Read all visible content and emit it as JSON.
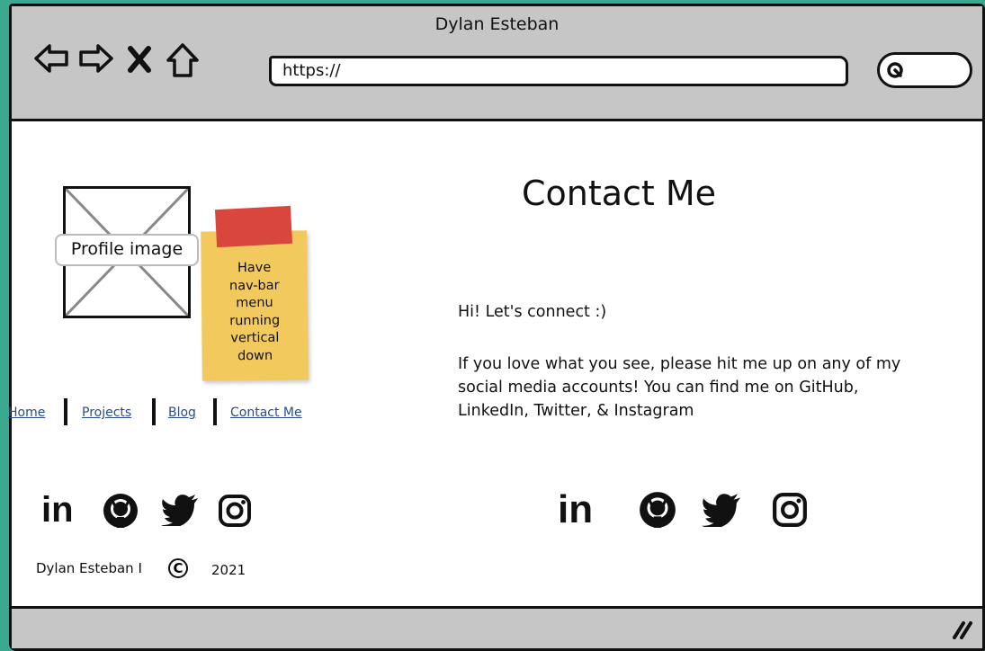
{
  "window": {
    "title": "Dylan Esteban"
  },
  "toolbar": {
    "url": "https://",
    "icons": [
      "back-arrow-icon",
      "forward-arrow-icon",
      "close-x-icon",
      "home-icon",
      "search-icon"
    ]
  },
  "sidebar": {
    "profile_label": "Profile image",
    "note": "Have\nnav-bar\nmenu\nrunning\nvertical\ndown",
    "nav": [
      "Home",
      "Projects",
      "Blog",
      "Contact Me"
    ],
    "social_icons": [
      "linkedin-icon",
      "github-icon",
      "twitter-icon",
      "instagram-icon"
    ],
    "footer_name": "Dylan Esteban I",
    "copyright_symbol": "C",
    "footer_year": "2021"
  },
  "main": {
    "heading": "Contact Me",
    "greeting": "Hi! Let's connect :)",
    "paragraph": "If you love what you see, please hit me up on any of my social media accounts! You can find me on GitHub, LinkedIn, Twitter, & Instagram",
    "social_icons": [
      "linkedin-icon",
      "github-icon",
      "twitter-icon",
      "instagram-icon"
    ]
  },
  "colors": {
    "background": "#3aa98f",
    "chrome": "#c6c6c6",
    "sticky_note": "#f1c95c",
    "tape": "#d9463d",
    "link": "#2b4c8a"
  }
}
